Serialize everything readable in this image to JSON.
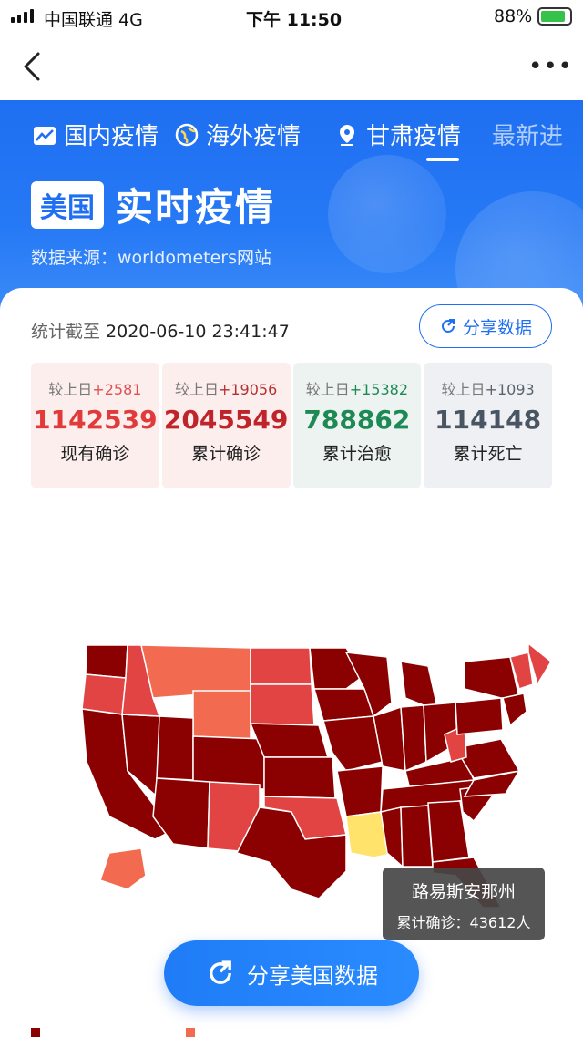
{
  "status_bar": {
    "carrier": "中国联通  4G",
    "time": "下午 11:50",
    "battery": "88%"
  },
  "nav": {
    "back_icon": "chevron-left-icon",
    "more_icon": "ellipsis-icon",
    "more_label": "•••"
  },
  "tabs": [
    {
      "label": "国内疫情",
      "icon": "chart-icon"
    },
    {
      "label": "海外疫情",
      "icon": "globe-icon"
    },
    {
      "label": "甘肃疫情",
      "icon": "location-pin-icon"
    },
    {
      "label": "最新进",
      "icon": ""
    }
  ],
  "header": {
    "badge": "美国",
    "title": "实时疫情",
    "source": "数据来源：worldometers网站"
  },
  "timestamp": {
    "label": "统计截至",
    "value": "2020-06-10 23:41:47"
  },
  "share_small": {
    "label": "分享数据",
    "icon": "share-icon"
  },
  "stats": [
    {
      "delta_label": "较上日",
      "delta": "+2581",
      "value": "1142539",
      "label": "现有确诊",
      "bg": "#fdeeee",
      "color": "#e03a3a",
      "delta_color": "#e05050"
    },
    {
      "delta_label": "较上日",
      "delta": "+19056",
      "value": "2045549",
      "label": "累计确诊",
      "bg": "#fdeeee",
      "color": "#c0242b",
      "delta_color": "#b53030"
    },
    {
      "delta_label": "较上日",
      "delta": "+15382",
      "value": "788862",
      "label": "累计治愈",
      "bg": "#edf3f1",
      "color": "#1d8a55",
      "delta_color": "#1d8a55"
    },
    {
      "delta_label": "较上日",
      "delta": "+1093",
      "value": "114148",
      "label": "累计死亡",
      "bg": "#eef0f3",
      "color": "#4a5563",
      "delta_color": "#5a6370"
    }
  ],
  "map": {
    "colors": {
      "dark": "#8b0000",
      "mid": "#e24444",
      "light": "#f26a4f",
      "highlight": "#ffe36a"
    }
  },
  "tooltip": {
    "title": "路易斯安那州",
    "detail": "累计确诊：43612人"
  },
  "share_big": {
    "label": "分享美国数据",
    "icon": "share-icon"
  }
}
